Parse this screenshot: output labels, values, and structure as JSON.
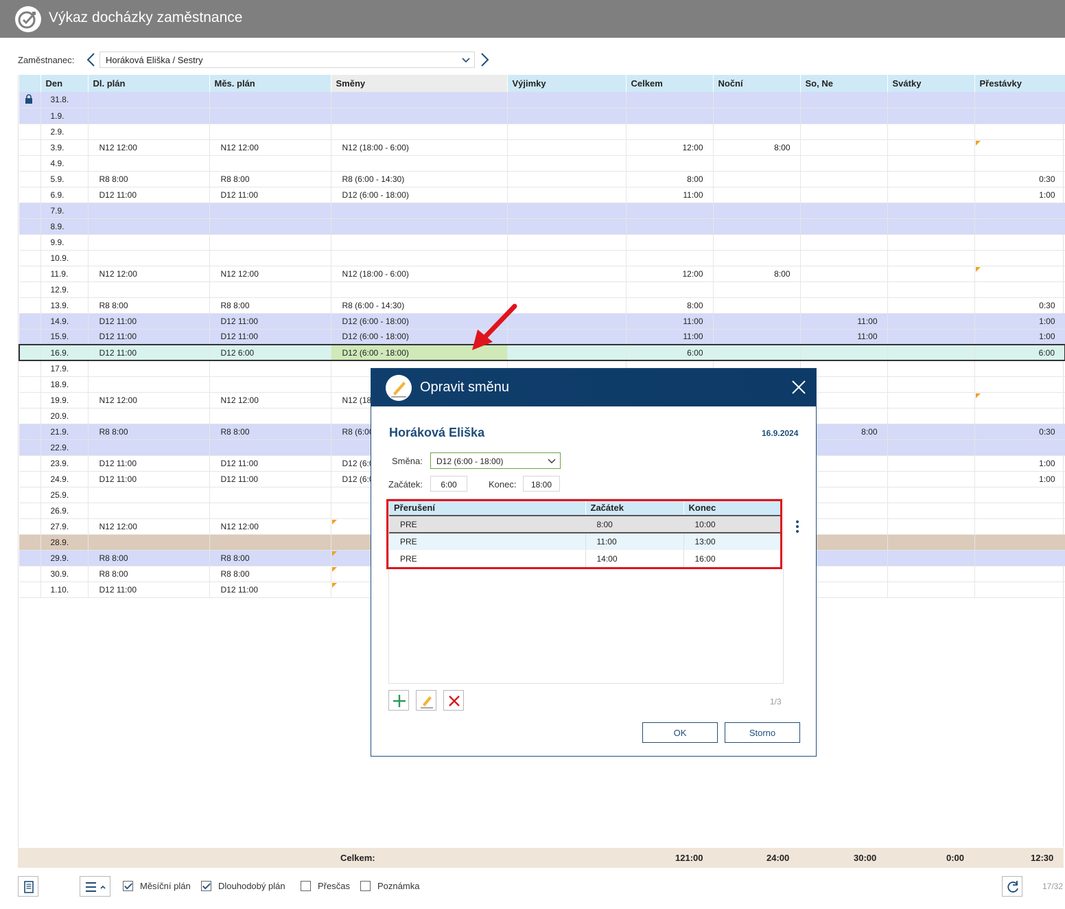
{
  "app": {
    "title": "Výkaz docházky zaměstnance"
  },
  "employee": {
    "label": "Zaměstnanec:",
    "value": "Horáková Eliška / Sestry"
  },
  "columns": [
    "Den",
    "Dl. plán",
    "Měs. plán",
    "Směny",
    "Výjimky",
    "Celkem",
    "Noční",
    "So, Ne",
    "Svátky",
    "Přestávky"
  ],
  "rows": [
    {
      "den": "31.8.",
      "dl": "",
      "mes": "",
      "smeny": "",
      "vyj": "",
      "celkem": "",
      "nocni": "",
      "sone": "",
      "svatky": "",
      "prest": ""
    },
    {
      "den": "1.9.",
      "dl": "",
      "mes": "",
      "smeny": "",
      "vyj": "",
      "celkem": "",
      "nocni": "",
      "sone": "",
      "svatky": "",
      "prest": ""
    },
    {
      "den": "2.9.",
      "dl": "",
      "mes": "",
      "smeny": "",
      "vyj": "",
      "celkem": "",
      "nocni": "",
      "sone": "",
      "svatky": "",
      "prest": ""
    },
    {
      "den": "3.9.",
      "dl": "N12 12:00",
      "mes": "N12 12:00",
      "smeny": "N12 (18:00 - 6:00)",
      "vyj": "",
      "celkem": "12:00",
      "nocni": "8:00",
      "sone": "",
      "svatky": "",
      "prest": ""
    },
    {
      "den": "4.9.",
      "dl": "",
      "mes": "",
      "smeny": "",
      "vyj": "",
      "celkem": "",
      "nocni": "",
      "sone": "",
      "svatky": "",
      "prest": ""
    },
    {
      "den": "5.9.",
      "dl": "R8 8:00",
      "mes": "R8 8:00",
      "smeny": "R8 (6:00 - 14:30)",
      "vyj": "",
      "celkem": "8:00",
      "nocni": "",
      "sone": "",
      "svatky": "",
      "prest": "0:30"
    },
    {
      "den": "6.9.",
      "dl": "D12 11:00",
      "mes": "D12 11:00",
      "smeny": "D12 (6:00 - 18:00)",
      "vyj": "",
      "celkem": "11:00",
      "nocni": "",
      "sone": "",
      "svatky": "",
      "prest": "1:00"
    },
    {
      "den": "7.9.",
      "dl": "",
      "mes": "",
      "smeny": "",
      "vyj": "",
      "celkem": "",
      "nocni": "",
      "sone": "",
      "svatky": "",
      "prest": ""
    },
    {
      "den": "8.9.",
      "dl": "",
      "mes": "",
      "smeny": "",
      "vyj": "",
      "celkem": "",
      "nocni": "",
      "sone": "",
      "svatky": "",
      "prest": ""
    },
    {
      "den": "9.9.",
      "dl": "",
      "mes": "",
      "smeny": "",
      "vyj": "",
      "celkem": "",
      "nocni": "",
      "sone": "",
      "svatky": "",
      "prest": ""
    },
    {
      "den": "10.9.",
      "dl": "",
      "mes": "",
      "smeny": "",
      "vyj": "",
      "celkem": "",
      "nocni": "",
      "sone": "",
      "svatky": "",
      "prest": ""
    },
    {
      "den": "11.9.",
      "dl": "N12 12:00",
      "mes": "N12 12:00",
      "smeny": "N12 (18:00 - 6:00)",
      "vyj": "",
      "celkem": "12:00",
      "nocni": "8:00",
      "sone": "",
      "svatky": "",
      "prest": ""
    },
    {
      "den": "12.9.",
      "dl": "",
      "mes": "",
      "smeny": "",
      "vyj": "",
      "celkem": "",
      "nocni": "",
      "sone": "",
      "svatky": "",
      "prest": ""
    },
    {
      "den": "13.9.",
      "dl": "R8 8:00",
      "mes": "R8 8:00",
      "smeny": "R8 (6:00 - 14:30)",
      "vyj": "",
      "celkem": "8:00",
      "nocni": "",
      "sone": "",
      "svatky": "",
      "prest": "0:30"
    },
    {
      "den": "14.9.",
      "dl": "D12 11:00",
      "mes": "D12 11:00",
      "smeny": "D12 (6:00 - 18:00)",
      "vyj": "",
      "celkem": "11:00",
      "nocni": "",
      "sone": "11:00",
      "svatky": "",
      "prest": "1:00"
    },
    {
      "den": "15.9.",
      "dl": "D12 11:00",
      "mes": "D12 11:00",
      "smeny": "D12 (6:00 - 18:00)",
      "vyj": "",
      "celkem": "11:00",
      "nocni": "",
      "sone": "11:00",
      "svatky": "",
      "prest": "1:00"
    },
    {
      "den": "16.9.",
      "dl": "D12 11:00",
      "mes": "D12 6:00",
      "smeny": "D12 (6:00 - 18:00)",
      "vyj": "",
      "celkem": "6:00",
      "nocni": "",
      "sone": "",
      "svatky": "",
      "prest": "6:00"
    },
    {
      "den": "17.9.",
      "dl": "",
      "mes": "",
      "smeny": "",
      "vyj": "",
      "celkem": "",
      "nocni": "",
      "sone": "",
      "svatky": "",
      "prest": ""
    },
    {
      "den": "18.9.",
      "dl": "",
      "mes": "",
      "smeny": "",
      "vyj": "",
      "celkem": "",
      "nocni": "",
      "sone": "",
      "svatky": "",
      "prest": ""
    },
    {
      "den": "19.9.",
      "dl": "N12 12:00",
      "mes": "N12 12:00",
      "smeny": "N12 (18",
      "vyj": "",
      "celkem": "",
      "nocni": "",
      "sone": "",
      "svatky": "",
      "prest": ""
    },
    {
      "den": "20.9.",
      "dl": "",
      "mes": "",
      "smeny": "",
      "vyj": "",
      "celkem": "",
      "nocni": "",
      "sone": "",
      "svatky": "",
      "prest": ""
    },
    {
      "den": "21.9.",
      "dl": "R8 8:00",
      "mes": "R8 8:00",
      "smeny": "R8 (6:00",
      "vyj": "",
      "celkem": "",
      "nocni": "",
      "sone": "8:00",
      "svatky": "",
      "prest": "0:30"
    },
    {
      "den": "22.9.",
      "dl": "",
      "mes": "",
      "smeny": "",
      "vyj": "",
      "celkem": "",
      "nocni": "",
      "sone": "",
      "svatky": "",
      "prest": ""
    },
    {
      "den": "23.9.",
      "dl": "D12 11:00",
      "mes": "D12 11:00",
      "smeny": "D12 (6:0",
      "vyj": "",
      "celkem": "",
      "nocni": "",
      "sone": "",
      "svatky": "",
      "prest": "1:00"
    },
    {
      "den": "24.9.",
      "dl": "D12 11:00",
      "mes": "D12 11:00",
      "smeny": "D12 (6:0",
      "vyj": "",
      "celkem": "",
      "nocni": "",
      "sone": "",
      "svatky": "",
      "prest": "1:00"
    },
    {
      "den": "25.9.",
      "dl": "",
      "mes": "",
      "smeny": "",
      "vyj": "",
      "celkem": "",
      "nocni": "",
      "sone": "",
      "svatky": "",
      "prest": ""
    },
    {
      "den": "26.9.",
      "dl": "",
      "mes": "",
      "smeny": "",
      "vyj": "",
      "celkem": "",
      "nocni": "",
      "sone": "",
      "svatky": "",
      "prest": ""
    },
    {
      "den": "27.9.",
      "dl": "N12 12:00",
      "mes": "N12 12:00",
      "smeny": "",
      "vyj": "",
      "celkem": "",
      "nocni": "",
      "sone": "",
      "svatky": "",
      "prest": ""
    },
    {
      "den": "28.9.",
      "dl": "",
      "mes": "",
      "smeny": "",
      "vyj": "",
      "celkem": "",
      "nocni": "",
      "sone": "",
      "svatky": "",
      "prest": ""
    },
    {
      "den": "29.9.",
      "dl": "R8 8:00",
      "mes": "R8 8:00",
      "smeny": "",
      "vyj": "",
      "celkem": "",
      "nocni": "",
      "sone": "",
      "svatky": "",
      "prest": ""
    },
    {
      "den": "30.9.",
      "dl": "R8 8:00",
      "mes": "R8 8:00",
      "smeny": "",
      "vyj": "",
      "celkem": "",
      "nocni": "",
      "sone": "",
      "svatky": "",
      "prest": ""
    },
    {
      "den": "1.10.",
      "dl": "D12 11:00",
      "mes": "D12 11:00",
      "smeny": "",
      "vyj": "",
      "celkem": "",
      "nocni": "",
      "sone": "",
      "svatky": "",
      "prest": ""
    }
  ],
  "totals": {
    "label": "Celkem:",
    "celkem": "121:00",
    "nocni": "24:00",
    "sone": "30:00",
    "svatky": "0:00",
    "prest": "12:30"
  },
  "bottom": {
    "checkboxes": [
      {
        "label": "Měsíční plán",
        "checked": true
      },
      {
        "label": "Dlouhodobý plán",
        "checked": true
      },
      {
        "label": "Přesčas",
        "checked": false
      },
      {
        "label": "Poznámka",
        "checked": false
      }
    ],
    "pager": "17/32"
  },
  "modal": {
    "title": "Opravit směnu",
    "name": "Horáková Eliška",
    "date": "16.9.2024",
    "smena_label": "Směna:",
    "smena_value": "D12 (6:00 - 18:00)",
    "zacatek_label": "Začátek:",
    "zacatek_value": "6:00",
    "konec_label": "Konec:",
    "konec_value": "18:00",
    "breaks_columns": [
      "Přerušení",
      "Začátek",
      "Konec"
    ],
    "breaks": [
      {
        "type": "PRE",
        "start": "8:00",
        "end": "10:00"
      },
      {
        "type": "PRE",
        "start": "11:00",
        "end": "13:00"
      },
      {
        "type": "PRE",
        "start": "14:00",
        "end": "16:00"
      }
    ],
    "count": "1/3",
    "ok_label": "OK",
    "cancel_label": "Storno"
  },
  "colors": {
    "titlebar": "#7f7f7f",
    "header": "#cfe9f6",
    "weekend": "#d4daf7",
    "holiday": "#dccbbb",
    "selected": "#d8f3ee",
    "modal_head": "#0d3a66",
    "highlight_frame": "#e0141c",
    "arrow": "#e0141c"
  },
  "icons": {
    "app": "clock-check-icon",
    "modal": "pencil-icon",
    "close": "close-icon",
    "lock": "lock-icon",
    "prev": "chevron-left-icon",
    "next": "chevron-right-icon"
  }
}
